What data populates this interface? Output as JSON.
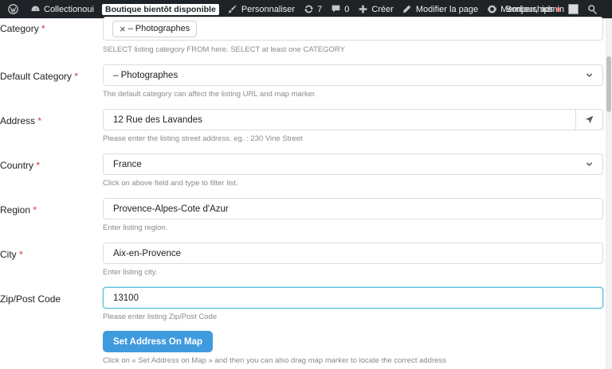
{
  "adminbar": {
    "site_name": "Collectionoui",
    "maintenance_badge": "Boutique bientôt disponible",
    "customize": "Personnaliser",
    "updates_count": "7",
    "comments_count": "0",
    "new": "Créer",
    "edit_page": "Modifier la page",
    "memberships": "Memberships",
    "greeting": "Bonjour, admin"
  },
  "form": {
    "category": {
      "label": "Category",
      "required": "*",
      "chip_remove": "×",
      "chip_value": "– Photographes",
      "help": "SELECT listing category FROM here. SELECT at least one CATEGORY"
    },
    "default_category": {
      "label": "Default Category",
      "required": "*",
      "value": "– Photographes",
      "help": "The default category can affect the listing URL and map marker."
    },
    "address": {
      "label": "Address",
      "required": "*",
      "value": "12 Rue des Lavandes",
      "help": "Please enter the listing street address. eg. : 230 Vine Street"
    },
    "country": {
      "label": "Country",
      "required": "*",
      "value": "France",
      "help": "Click on above field and type to filter list."
    },
    "region": {
      "label": "Region",
      "required": "*",
      "value": "Provence-Alpes-Cote d'Azur",
      "help": "Enter listing region."
    },
    "city": {
      "label": "City",
      "required": "*",
      "value": "Aix-en-Provence",
      "help": "Enter listing city."
    },
    "zip": {
      "label": "Zip/Post Code",
      "value": "13100",
      "help": "Please enter listing Zip/Post Code"
    },
    "set_address_button": "Set Address On Map",
    "set_address_help": "Click on « Set Address on Map » and then you can also drag map marker to locate the correct address"
  },
  "colors": {
    "adminbar_bg": "#1d2327",
    "required": "#d63638",
    "button_bg": "#3f9bde",
    "focus_border": "#5bbcd6"
  }
}
